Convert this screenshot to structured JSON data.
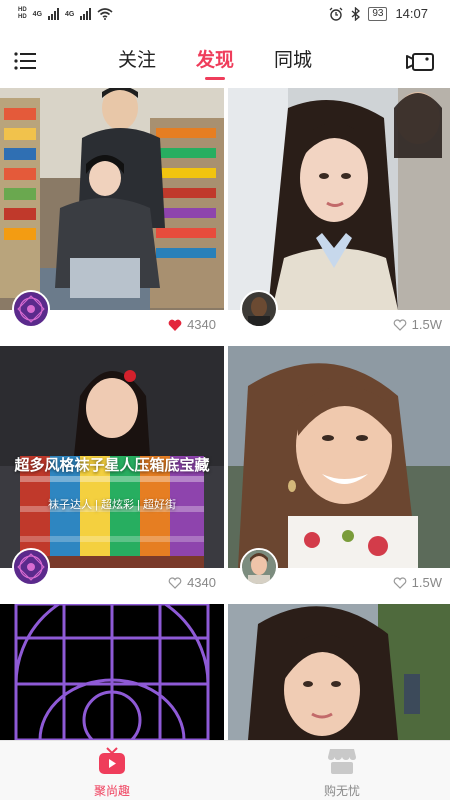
{
  "status_bar": {
    "hd1": "HD",
    "hd2": "HD",
    "net1": "4G",
    "net2": "4G",
    "battery": "93",
    "time": "14:07"
  },
  "top_nav": {
    "tabs": [
      {
        "label": "关注",
        "active": false
      },
      {
        "label": "发现",
        "active": true
      },
      {
        "label": "同城",
        "active": false
      }
    ]
  },
  "feed": {
    "cards": [
      {
        "likes": "4340",
        "liked": true
      },
      {
        "likes": "1.5W",
        "liked": false
      },
      {
        "likes": "4340",
        "liked": false,
        "title": "超多风格袜子星人压箱底宝藏",
        "subtitle": "袜子达人 | 超炫彩 | 超好街"
      },
      {
        "likes": "1.5W",
        "liked": false
      }
    ]
  },
  "bottom_bar": {
    "items": [
      {
        "label": "聚尚趣",
        "active": true
      },
      {
        "label": "购无忧",
        "active": false
      }
    ]
  },
  "colors": {
    "accent": "#ef3d5b",
    "muted": "#8a8a8a"
  }
}
